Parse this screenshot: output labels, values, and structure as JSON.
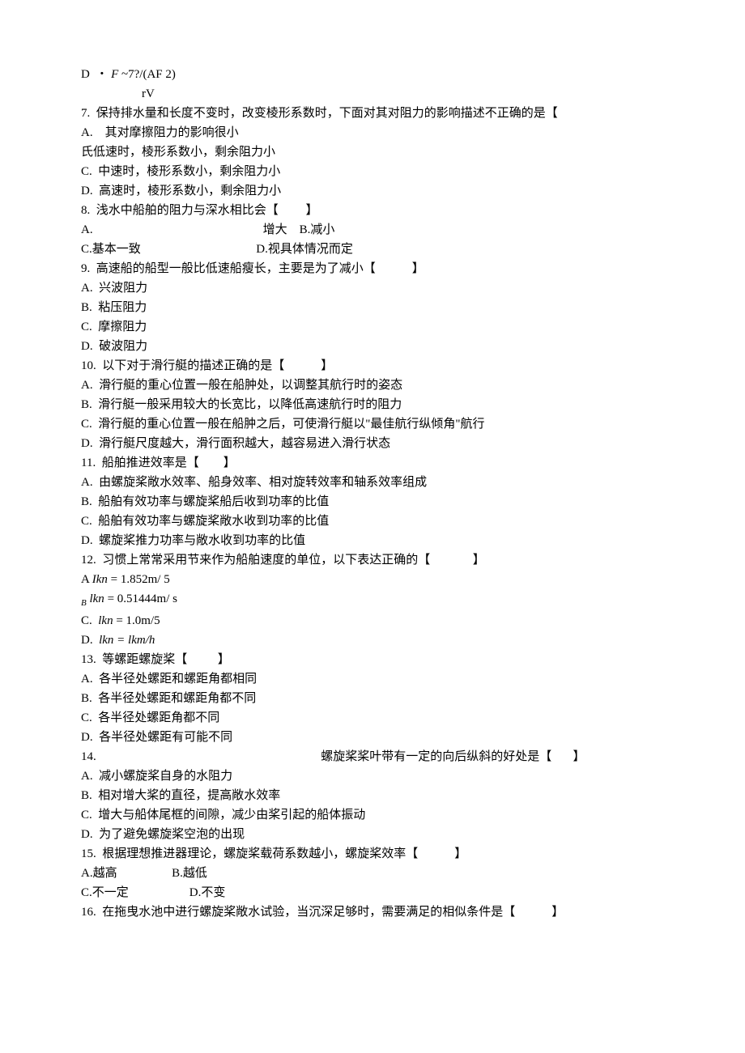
{
  "lines": [
    {
      "text": "D  ・ F ~7?/(AF 2)",
      "class": "formula"
    },
    {
      "text": "                    rV",
      "class": "formula"
    },
    {
      "text": "7.  保持排水量和长度不变时，改变棱形系数时，下面对其对阻力的影响描述不正确的是【"
    },
    {
      "text": "A.    其对摩擦阻力的影响很小"
    },
    {
      "text": "氏低速时，棱形系数小，剩余阻力小"
    },
    {
      "text": "C.  中速时，棱形系数小，剩余阻力小"
    },
    {
      "text": "D.  高速时，棱形系数小，剩余阻力小"
    },
    {
      "text": "8.  浅水中船舶的阻力与深水相比会【         】"
    },
    {
      "text": "A.                                                        增大    B.减小"
    },
    {
      "text": "C.基本一致                                      D.视具体情况而定"
    },
    {
      "text": "9.  高速船的船型一般比低速船瘦长，主要是为了减小【            】"
    },
    {
      "text": "A.  兴波阻力"
    },
    {
      "text": "B.  粘压阻力"
    },
    {
      "text": "C.  摩擦阻力"
    },
    {
      "text": "D.  破波阻力"
    },
    {
      "text": "10.  以下对于滑行艇的描述正确的是【            】"
    },
    {
      "text": "A.  滑行艇的重心位置一般在船肿处，以调整其航行时的姿态"
    },
    {
      "text": "B.  滑行艇一般采用较大的长宽比，以降低高速航行时的阻力"
    },
    {
      "text": "C.  滑行艇的重心位置一般在船肿之后，可使滑行艇以\"最佳航行纵倾角\"航行"
    },
    {
      "text": "D.  滑行艇尺度越大，滑行面积越大，越容易进入滑行状态"
    },
    {
      "text": "11.  船舶推进效率是【        】"
    },
    {
      "text": "A.  由螺旋桨敞水效率、船身效率、相对旋转效率和轴系效率组成"
    },
    {
      "text": "B.  船舶有效功率与螺旋桨船后收到功率的比值"
    },
    {
      "text": "C.  船舶有效功率与螺旋桨敞水收到功率的比值"
    },
    {
      "text": "D.  螺旋桨推力功率与敞水收到功率的比值"
    },
    {
      "text": "12.  习惯上常常采用节来作为船舶速度的单位，以下表达正确的【              】"
    },
    {
      "text": ""
    },
    {
      "text": "A Ikn = 1.852m/ 5",
      "class": "formula"
    },
    {
      "text": ""
    },
    {
      "text": "B lkn = 0.51444m/ s",
      "class": "formula italic-prefix"
    },
    {
      "text": ""
    },
    {
      "text": "C.  lkn = 1.0m/5",
      "class": "formula"
    },
    {
      "text": "D.  lkn = lkm/h",
      "class": "formula"
    },
    {
      "text": "13.  等螺距螺旋桨【          】"
    },
    {
      "text": "A.  各半径处螺距和螺距角都相同"
    },
    {
      "text": "B.  各半径处螺距和螺距角都不同"
    },
    {
      "text": "C.  各半径处螺距角都不同"
    },
    {
      "text": "D.  各半径处螺距有可能不同"
    },
    {
      "text": "14.                                                                          螺旋桨桨叶带有一定的向后纵斜的好处是【       】"
    },
    {
      "text": "A.  减小螺旋桨自身的水阻力"
    },
    {
      "text": "B.  相对增大桨的直径，提高敞水效率"
    },
    {
      "text": "C.  增大与船体尾框的间隙，减少由桨引起的船体振动"
    },
    {
      "text": "D.  为了避免螺旋桨空泡的出现"
    },
    {
      "text": "15.  根据理想推进器理论，螺旋桨载荷系数越小，螺旋桨效率【            】"
    },
    {
      "text": "A.越高                  B.越低"
    },
    {
      "text": "C.不一定                    D.不变"
    },
    {
      "text": "16.  在拖曳水池中进行螺旋桨敞水试验，当沉深足够时，需要满足的相似条件是【            】"
    }
  ]
}
